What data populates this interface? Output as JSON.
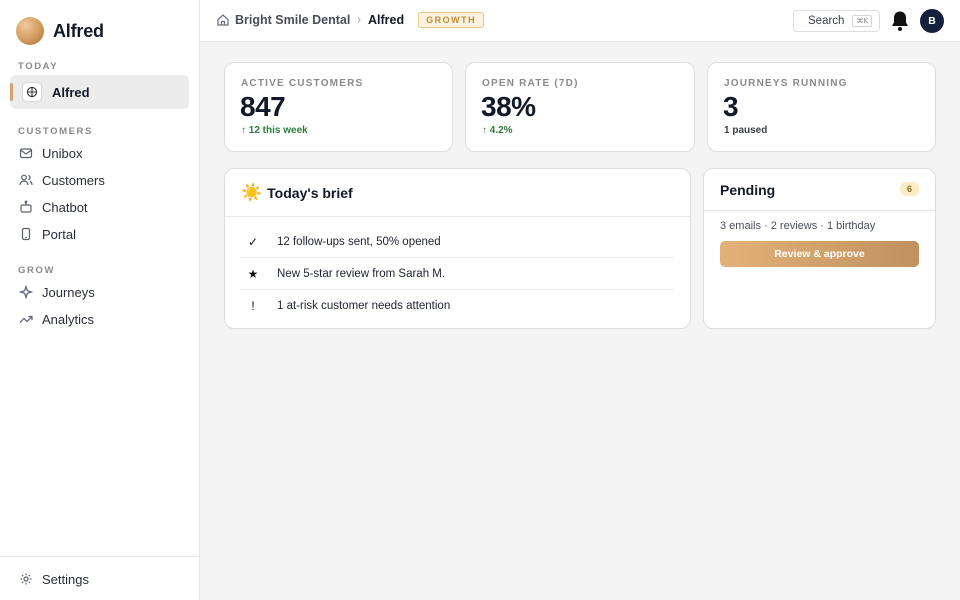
{
  "brand": {
    "name": "Alfred"
  },
  "sidebar": {
    "sections": [
      {
        "label": "TODAY"
      },
      {
        "label": "CUSTOMERS"
      },
      {
        "label": "GROW"
      }
    ],
    "items": [
      {
        "label": "Alfred",
        "icon": "gift-icon",
        "active": true
      },
      {
        "label": "Unibox",
        "icon": "inbox-icon"
      },
      {
        "label": "Customers",
        "icon": "users-icon"
      },
      {
        "label": "Chatbot",
        "icon": "bot-icon"
      },
      {
        "label": "Portal",
        "icon": "phone-icon"
      },
      {
        "label": "Journeys",
        "icon": "sparkle-icon"
      },
      {
        "label": "Analytics",
        "icon": "trend-icon"
      }
    ],
    "footer": {
      "label": "Settings",
      "icon": "gear-icon"
    }
  },
  "topbar": {
    "org": "Bright Smile Dental",
    "separator": "›",
    "current": "Alfred",
    "tier": "GROWTH",
    "search_label": "Search",
    "search_shortcut": "⌘K",
    "avatar_initial": "B"
  },
  "stats": [
    {
      "label": "ACTIVE CUSTOMERS",
      "value": "847",
      "delta": "↑ 12 this week"
    },
    {
      "label": "OPEN RATE (7D)",
      "value": "38%",
      "delta": "↑ 4.2%"
    },
    {
      "label": "JOURNEYS RUNNING",
      "value": "3",
      "delta": "1 paused"
    }
  ],
  "brief": {
    "icon": "☀️",
    "title": "Today's brief",
    "items": [
      {
        "mark": "✓",
        "text": "12 follow-ups sent, 50% opened"
      },
      {
        "mark": "★",
        "text": "New 5-star review from Sarah M."
      },
      {
        "mark": "!",
        "text": "1 at-risk customer needs attention"
      }
    ]
  },
  "pending": {
    "title": "Pending",
    "count": "6",
    "summary": "3 emails · 2 reviews · 1 birthday",
    "button_label": "Review & approve"
  },
  "colors": {
    "accent": "#d7a26a",
    "positive": "#2f7a3c",
    "avatar_bg": "#14213d"
  }
}
